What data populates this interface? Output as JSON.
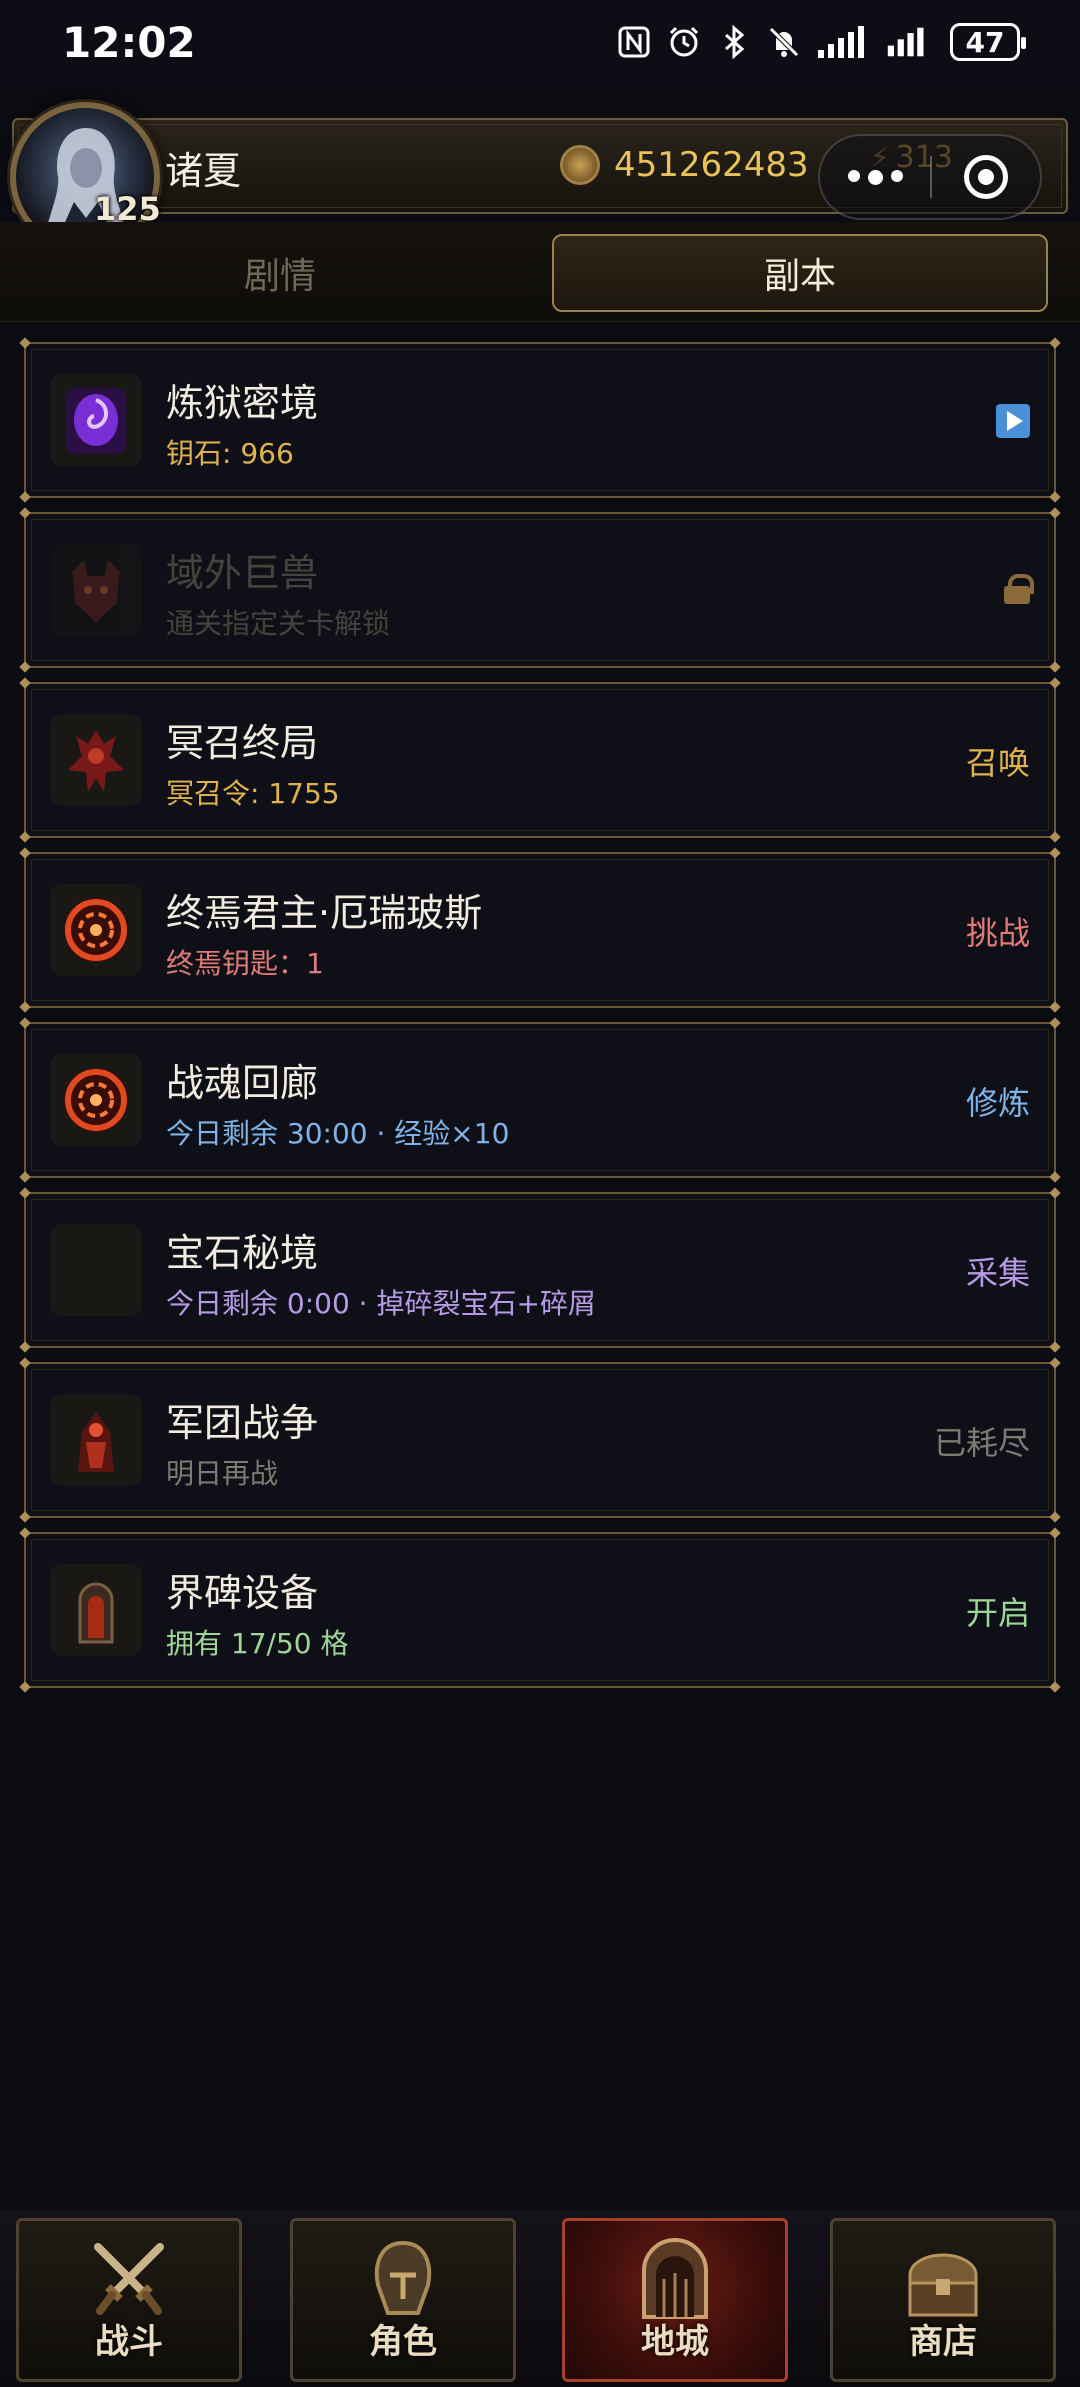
{
  "status_bar": {
    "time": "12:02",
    "battery": "47",
    "icons": [
      "nfc-icon",
      "alarm-icon",
      "bluetooth-icon",
      "mute-icon",
      "signal-icon",
      "signal-icon"
    ]
  },
  "player": {
    "name": "诸夏",
    "level": "125",
    "gold": "451262483",
    "energy": "313"
  },
  "tabs": [
    {
      "label": "剧情",
      "active": false
    },
    {
      "label": "副本",
      "active": true
    }
  ],
  "dungeons": [
    {
      "title": "炼狱密境",
      "sub": "钥石: 966",
      "sub_color": "#e0b24f",
      "action": "",
      "action_type": "play",
      "icon": "purple-portal-icon"
    },
    {
      "title": "域外巨兽",
      "sub": "通关指定关卡解锁",
      "sub_color": "#45423c",
      "action": "",
      "action_type": "lock",
      "icon": "beast-icon"
    },
    {
      "title": "冥召终局",
      "sub": "冥召令: 1755",
      "sub_color": "#e0b24f",
      "action": "召唤",
      "action_color": "#e0b24f",
      "icon": "demon-icon"
    },
    {
      "title": "终焉君主·厄瑞玻斯",
      "sub": "终焉钥匙：1",
      "sub_color": "#e07b78",
      "action": "挑战",
      "action_color": "#e07b78",
      "icon": "fire-portal-icon"
    },
    {
      "title": "战魂回廊",
      "sub": "今日剩余 30:00 · 经验×10",
      "sub_color": "#7fb3e8",
      "action": "修炼",
      "action_color": "#7fb3e8",
      "icon": "fire-portal-icon"
    },
    {
      "title": "宝石秘境",
      "sub": "今日剩余 0:00 · 掉碎裂宝石+碎屑",
      "sub_color": "#b69ae8",
      "action": "采集",
      "action_color": "#b69ae8",
      "icon": "empty-icon"
    },
    {
      "title": "军团战争",
      "sub": "明日再战",
      "sub_color": "#7d7a72",
      "action": "已耗尽",
      "action_color": "#7d7a72",
      "icon": "legion-icon"
    },
    {
      "title": "界碑设备",
      "sub": "拥有 17/50 格",
      "sub_color": "#9ed69a",
      "action": "开启",
      "action_color": "#9ed69a",
      "icon": "tombstone-icon"
    }
  ],
  "nav": [
    {
      "label": "战斗",
      "icon": "crossed-swords-icon",
      "active": false
    },
    {
      "label": "角色",
      "icon": "helmet-icon",
      "active": false
    },
    {
      "label": "地城",
      "icon": "dungeon-gate-icon",
      "active": true
    },
    {
      "label": "商店",
      "icon": "treasure-chest-icon",
      "active": false
    }
  ]
}
